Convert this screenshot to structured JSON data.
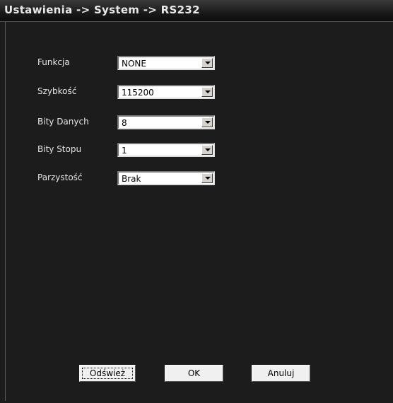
{
  "window": {
    "title": "Ustawienia -> System -> RS232"
  },
  "form": {
    "fields": [
      {
        "label": "Funkcja",
        "value": "NONE"
      },
      {
        "label": "Szybkość",
        "value": "115200"
      },
      {
        "label": "Bity Danych",
        "value": "8"
      },
      {
        "label": "Bity Stopu",
        "value": "1"
      },
      {
        "label": "Parzystość",
        "value": "Brak"
      }
    ]
  },
  "buttons": {
    "refresh": "Odśwież",
    "ok": "OK",
    "cancel": "Anuluj"
  },
  "colors": {
    "background": "#1c1c1c",
    "text": "#e6e6e6",
    "button_face": "#f0f0f0"
  },
  "icons": {
    "dropdown": "chevron-down-icon"
  }
}
